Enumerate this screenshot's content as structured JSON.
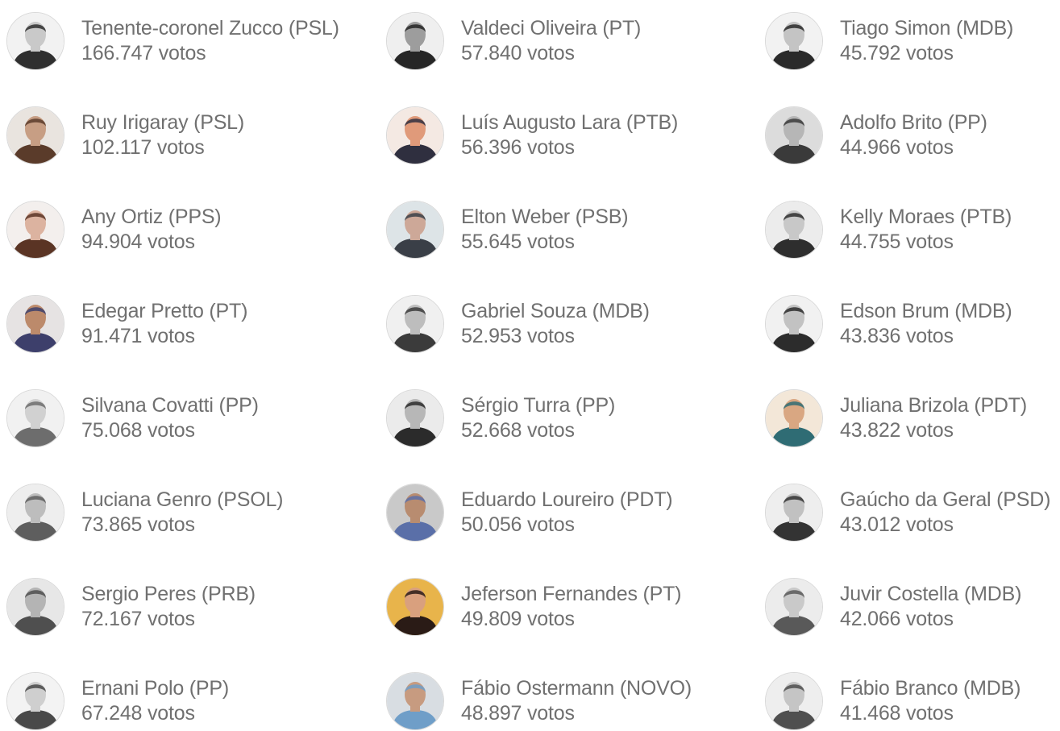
{
  "columns": [
    [
      {
        "name": "Tenente-coronel Zucco (PSL)",
        "votes": "166.747 votos",
        "palette": [
          "#f2f2f2",
          "#c9c9c9",
          "#2f2f2f"
        ]
      },
      {
        "name": "Ruy Irigaray (PSL)",
        "votes": "102.117 votos",
        "palette": [
          "#e9e4df",
          "#c79e84",
          "#5a3b2a"
        ]
      },
      {
        "name": "Any Ortiz (PPS)",
        "votes": "94.904 votos",
        "palette": [
          "#f3efed",
          "#dcb3a0",
          "#5a3424"
        ]
      },
      {
        "name": "Edegar Pretto (PT)",
        "votes": "91.471 votos",
        "palette": [
          "#e6e3e3",
          "#bc8a6b",
          "#3d3f6b"
        ]
      },
      {
        "name": "Silvana Covatti (PP)",
        "votes": "75.068 votos",
        "palette": [
          "#f1f1f1",
          "#d1d1d1",
          "#6d6d6d"
        ]
      },
      {
        "name": "Luciana Genro (PSOL)",
        "votes": "73.865 votos",
        "palette": [
          "#eeeeee",
          "#bdbdbd",
          "#5e5e5e"
        ]
      },
      {
        "name": "Sergio Peres (PRB)",
        "votes": "72.167 votos",
        "palette": [
          "#e7e7e7",
          "#b4b4b4",
          "#4f4f4f"
        ]
      },
      {
        "name": "Ernani Polo (PP)",
        "votes": "67.248 votos",
        "palette": [
          "#f3f3f3",
          "#cfcfcf",
          "#494949"
        ]
      }
    ],
    [
      {
        "name": "Valdeci Oliveira (PT)",
        "votes": "57.840 votos",
        "palette": [
          "#efefef",
          "#9d9d9d",
          "#262626"
        ]
      },
      {
        "name": "Luís Augusto Lara (PTB)",
        "votes": "56.396 votos",
        "palette": [
          "#f4e9e3",
          "#e09a7a",
          "#2f2f3f"
        ]
      },
      {
        "name": "Elton Weber (PSB)",
        "votes": "55.645 votos",
        "palette": [
          "#dde4e7",
          "#cda898",
          "#3a3f47"
        ]
      },
      {
        "name": "Gabriel Souza (MDB)",
        "votes": "52.953 votos",
        "palette": [
          "#f0f0f0",
          "#bdbdbd",
          "#3b3b3b"
        ]
      },
      {
        "name": "Sérgio Turra (PP)",
        "votes": "52.668 votos",
        "palette": [
          "#ebebeb",
          "#b7b7b7",
          "#2b2b2b"
        ]
      },
      {
        "name": "Eduardo Loureiro (PDT)",
        "votes": "50.056 votos",
        "palette": [
          "#c9c9c9",
          "#b88c70",
          "#5a6fa8"
        ]
      },
      {
        "name": "Jeferson Fernandes (PT)",
        "votes": "49.809 votos",
        "palette": [
          "#e8b44b",
          "#d9a07e",
          "#2a1b16"
        ]
      },
      {
        "name": "Fábio Ostermann (NOVO)",
        "votes": "48.897 votos",
        "palette": [
          "#d8dde2",
          "#c79b80",
          "#6f9ec8"
        ]
      }
    ],
    [
      {
        "name": "Tiago Simon (MDB)",
        "votes": "45.792 votos",
        "palette": [
          "#f2f2f2",
          "#c4c4c4",
          "#2a2a2a"
        ]
      },
      {
        "name": "Adolfo Brito (PP)",
        "votes": "44.966 votos",
        "palette": [
          "#dcdcdc",
          "#b6b6b6",
          "#3a3a3a"
        ]
      },
      {
        "name": "Kelly Moraes (PTB)",
        "votes": "44.755 votos",
        "palette": [
          "#ececec",
          "#c8c8c8",
          "#2e2e2e"
        ]
      },
      {
        "name": "Edson Brum (MDB)",
        "votes": "43.836 votos",
        "palette": [
          "#f1f1f1",
          "#c2c2c2",
          "#2c2c2c"
        ]
      },
      {
        "name": "Juliana Brizola (PDT)",
        "votes": "43.822 votos",
        "palette": [
          "#f3e7d8",
          "#d9a782",
          "#2f6c74"
        ]
      },
      {
        "name": "Gaúcho da Geral (PSD)",
        "votes": "43.012 votos",
        "palette": [
          "#eeeeee",
          "#c1c1c1",
          "#333333"
        ]
      },
      {
        "name": "Juvir Costella (MDB)",
        "votes": "42.066 votos",
        "palette": [
          "#ececec",
          "#c9c9c9",
          "#595959"
        ]
      },
      {
        "name": "Fábio Branco (MDB)",
        "votes": "41.468 votos",
        "palette": [
          "#eeeeee",
          "#c5c5c5",
          "#4f4f4f"
        ]
      }
    ]
  ]
}
